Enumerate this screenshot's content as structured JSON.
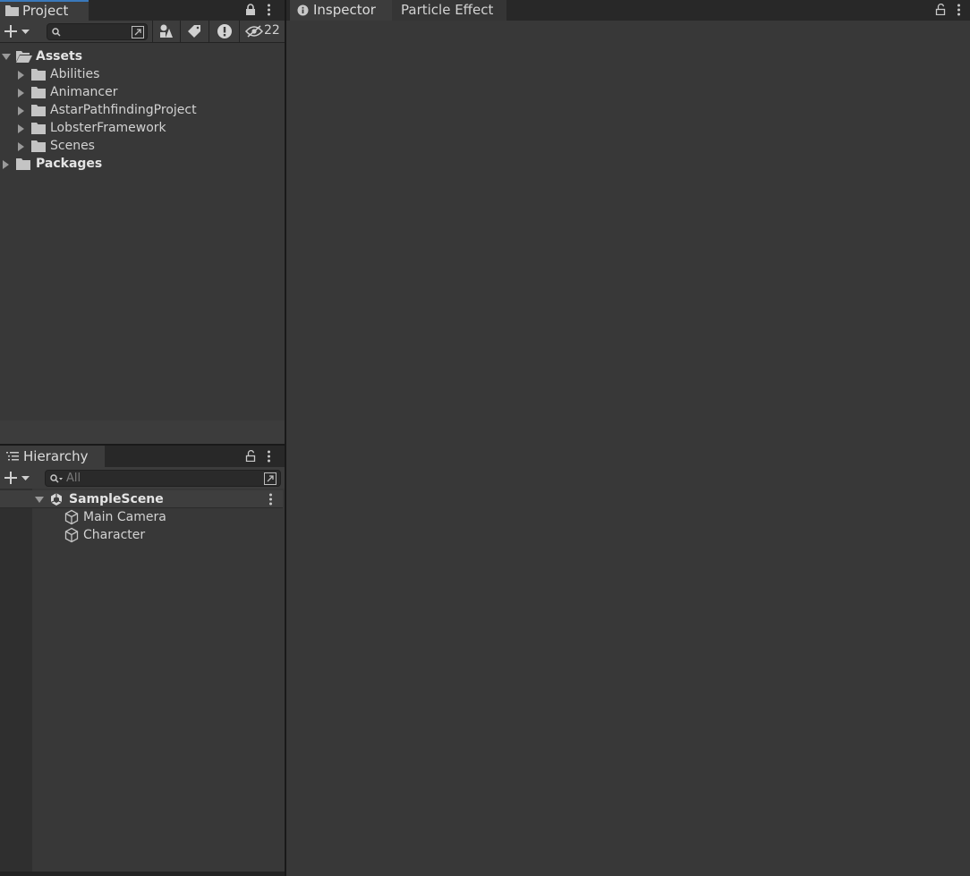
{
  "project_panel": {
    "tab_label": "Project",
    "search_value": "",
    "hidden_count": "22",
    "tree": [
      {
        "label": "Assets",
        "bold": true,
        "expanded": true
      },
      {
        "label": "Abilities"
      },
      {
        "label": "Animancer"
      },
      {
        "label": "AstarPathfindingProject"
      },
      {
        "label": "LobsterFramework"
      },
      {
        "label": "Scenes"
      },
      {
        "label": "Packages",
        "bold": true
      }
    ]
  },
  "hierarchy_panel": {
    "tab_label": "Hierarchy",
    "search_placeholder": "All",
    "scene_name": "SampleScene",
    "objects": [
      "Main Camera",
      "Character"
    ]
  },
  "inspector_panel": {
    "tabs": [
      "Inspector",
      "Particle Effect"
    ]
  },
  "colors": {
    "bg": "#383838",
    "tabbar": "#282828",
    "selected_tab_accent": "#3a79bb"
  }
}
